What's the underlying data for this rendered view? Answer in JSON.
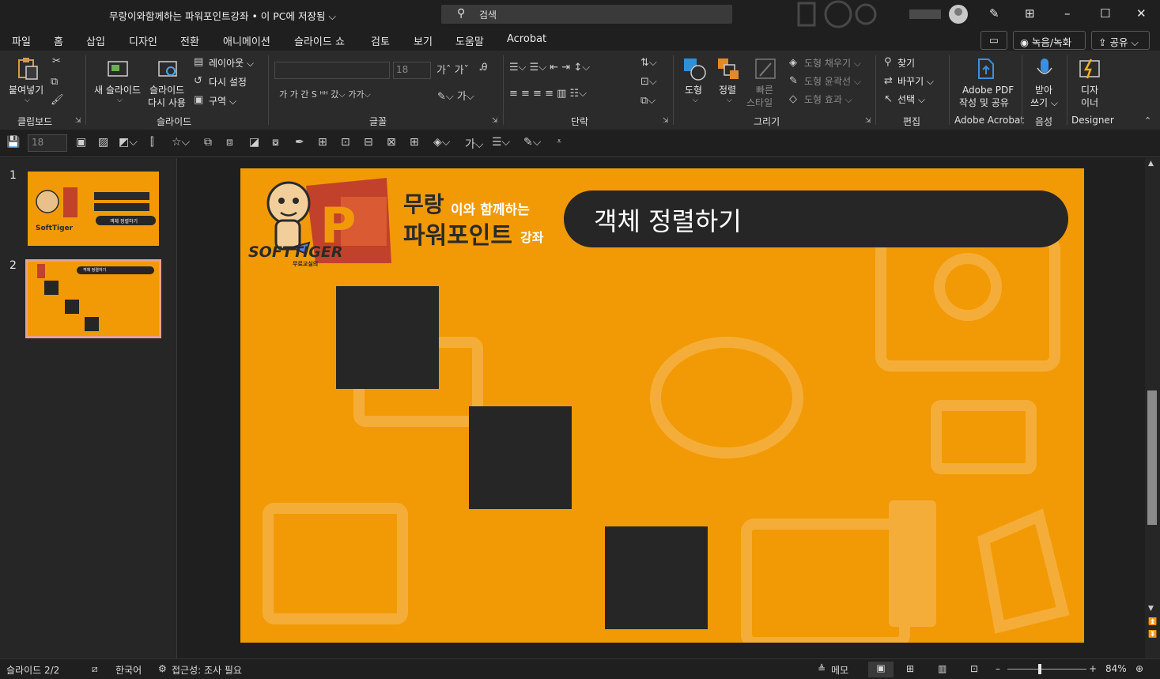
{
  "titlebar": {
    "doc_title": "무랑이와함께하는 파워포인트강좌 • 이 PC에 저장됨 ⌵",
    "search_placeholder": "검색"
  },
  "tabs": [
    "파일",
    "홈",
    "삽입",
    "디자인",
    "전환",
    "애니메이션",
    "슬라이드 쇼",
    "검토",
    "보기",
    "도움말",
    "Acrobat"
  ],
  "active_tab": "홈",
  "tab_actions": {
    "record": "◉ 녹음/녹화",
    "share": "⇪ 공유 ⌵"
  },
  "ribbon": {
    "clipboard": {
      "label": "클립보드",
      "paste": "붙여넣기"
    },
    "slides": {
      "label": "슬라이드",
      "new_slide_1": "새 슬라이드",
      "reuse_1": "슬라이드",
      "reuse_2": "다시 사용",
      "layout": "레이아웃 ⌵",
      "reset": "다시 설정",
      "section": "구역 ⌵"
    },
    "font": {
      "label": "글꼴",
      "size": "18"
    },
    "paragraph": {
      "label": "단락"
    },
    "drawing": {
      "label": "그리기",
      "shape": "도형",
      "arrange": "정렬",
      "quick_1": "빠른",
      "quick_2": "스타일",
      "fill": "도형 채우기 ⌵",
      "outline": "도형 윤곽선 ⌵",
      "effects": "도형 효과 ⌵"
    },
    "editing": {
      "label": "편집",
      "find": "찾기",
      "replace": "바꾸기  ⌵",
      "select": "선택 ⌵"
    },
    "acrobat": {
      "label": "Adobe Acrobat",
      "l1": "Adobe PDF",
      "l2": "작성 및 공유"
    },
    "voice": {
      "label": "음성",
      "l1": "받아",
      "l2": "쓰기 ⌵"
    },
    "designer": {
      "label": "Designer",
      "l1": "디자",
      "l2": "이너"
    }
  },
  "qat": {
    "font_size": "18"
  },
  "thumbnails": [
    {
      "num": "1",
      "title": "객체 정렬하기"
    },
    {
      "num": "2",
      "title": "객체 정렬하기"
    }
  ],
  "slide": {
    "title": "객체 정렬하기",
    "logo_line1": "무랑",
    "logo_line1b": "이와 함께하는",
    "logo_line2": "파워포인트",
    "logo_line2b": "강좌",
    "brand": "SOFTTIGER",
    "brand_sub": "무료교실의",
    "colors": {
      "background": "#f29a05",
      "dark": "#262626"
    }
  },
  "status": {
    "slide_index": "슬라이드 2/2",
    "language": "한국어",
    "accessibility": "접근성: 조사 필요",
    "notes": "메모",
    "zoom": "84%"
  }
}
